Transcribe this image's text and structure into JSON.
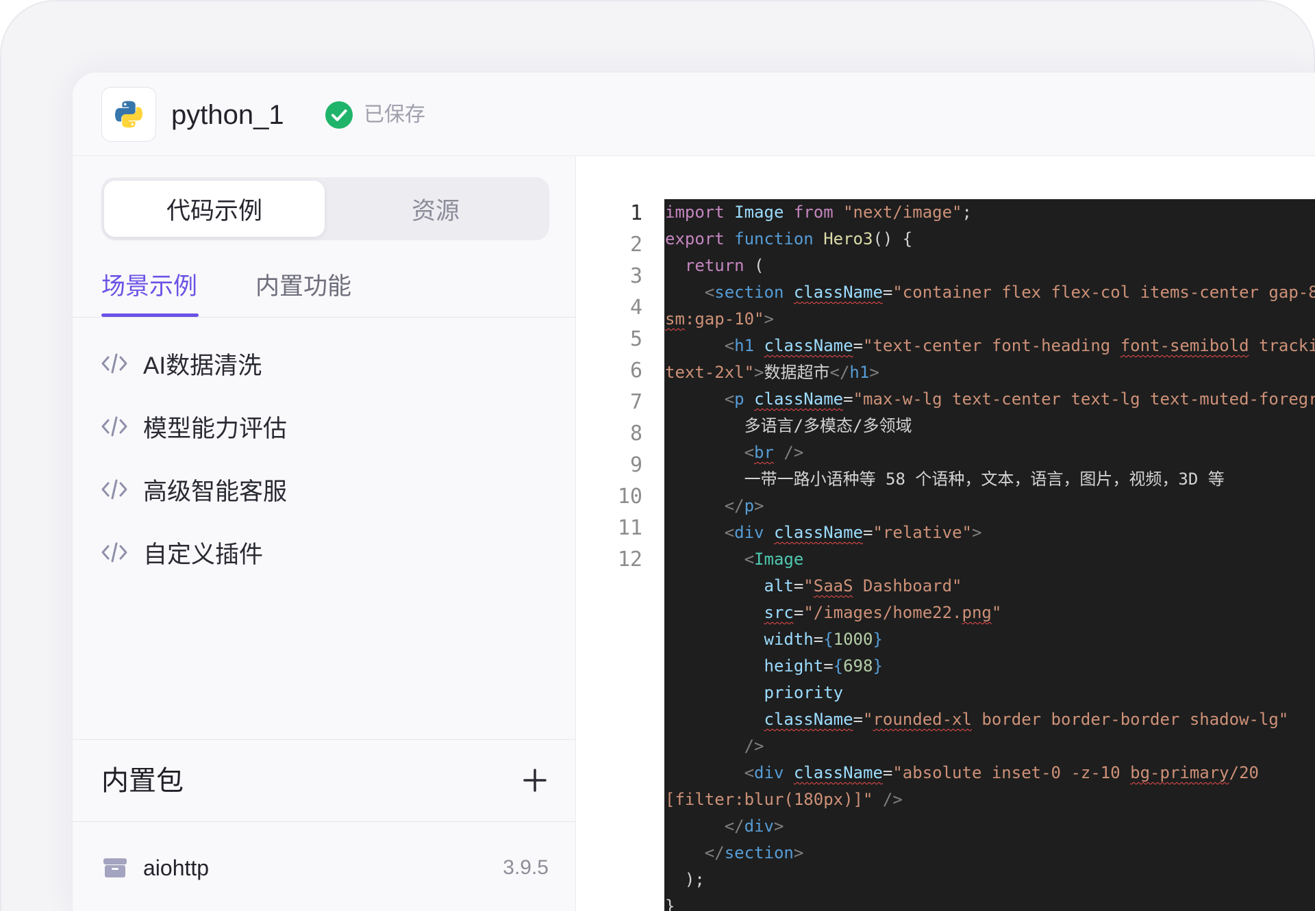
{
  "header": {
    "logo_icon": "python-logo-icon",
    "project_name": "python_1",
    "save_status_icon": "check-circle-icon",
    "save_status": "已保存"
  },
  "sidebar": {
    "segments": [
      {
        "label": "代码示例",
        "active": true
      },
      {
        "label": "资源",
        "active": false
      }
    ],
    "tabs": [
      {
        "label": "场景示例",
        "active": true
      },
      {
        "label": "内置功能",
        "active": false
      }
    ],
    "examples": [
      {
        "label": "AI数据清洗",
        "icon": "code-icon"
      },
      {
        "label": "模型能力评估",
        "icon": "code-icon"
      },
      {
        "label": "高级智能客服",
        "icon": "code-icon"
      },
      {
        "label": "自定义插件",
        "icon": "code-icon"
      }
    ],
    "packages_section": {
      "title": "内置包",
      "add_icon": "plus-icon"
    },
    "packages": [
      {
        "name": "aiohttp",
        "version": "3.9.5",
        "icon": "package-icon"
      }
    ]
  },
  "editor": {
    "line_numbers": [
      "1",
      "2",
      "3",
      "4",
      "5",
      "6",
      "7",
      "8",
      "9",
      "10",
      "11",
      "12"
    ],
    "active_line": 1,
    "code_lines": [
      [
        [
          "import",
          "#c586c0"
        ],
        [
          " Image",
          "#9cdcfe"
        ],
        [
          " from",
          "#c586c0"
        ],
        [
          " \"next/image\"",
          "#ce9178"
        ],
        [
          ";",
          "#d4d4d4"
        ]
      ],
      [
        [
          "export",
          "#c586c0"
        ],
        [
          " function",
          "#569cd6"
        ],
        [
          " Hero3",
          "#dcdcaa"
        ],
        [
          "() {",
          "#d4d4d4"
        ]
      ],
      [
        [
          "  return",
          "#c586c0"
        ],
        [
          " (",
          "#d4d4d4"
        ]
      ],
      [
        [
          "    <",
          "#808080"
        ],
        [
          "section",
          "#569cd6"
        ],
        [
          " ",
          "#d4d4d4"
        ],
        [
          "className",
          "#9cdcfe",
          true
        ],
        [
          "=",
          "#d4d4d4"
        ],
        [
          "\"container flex flex-col items-center gap-8",
          "#ce9178"
        ]
      ],
      [
        [
          "sm",
          "#ce9178",
          true
        ],
        [
          ":gap-10\"",
          "#ce9178"
        ],
        [
          ">",
          "#808080"
        ]
      ],
      [
        [
          "      <",
          "#808080"
        ],
        [
          "h1",
          "#569cd6"
        ],
        [
          " ",
          "#d4d4d4"
        ],
        [
          "className",
          "#9cdcfe",
          true
        ],
        [
          "=",
          "#d4d4d4"
        ],
        [
          "\"text-center font-heading ",
          "#ce9178"
        ],
        [
          "font-semibold",
          "#ce9178",
          true
        ],
        [
          " tracking",
          "#ce9178"
        ]
      ],
      [
        [
          "text-2xl\"",
          "#ce9178"
        ],
        [
          ">",
          "#808080"
        ],
        [
          "数据超市",
          "#d4d4d4"
        ],
        [
          "</",
          "#808080"
        ],
        [
          "h1",
          "#569cd6"
        ],
        [
          ">",
          "#808080"
        ]
      ],
      [
        [
          "      <",
          "#808080"
        ],
        [
          "p",
          "#569cd6"
        ],
        [
          " ",
          "#d4d4d4"
        ],
        [
          "className",
          "#9cdcfe",
          true
        ],
        [
          "=",
          "#d4d4d4"
        ],
        [
          "\"max-w-lg text-center text-lg text-muted-foregr",
          "#ce9178"
        ]
      ],
      [
        [
          "        多语言/多模态/多领域",
          "#d4d4d4"
        ]
      ],
      [
        [
          "        <",
          "#808080"
        ],
        [
          "br",
          "#569cd6",
          true
        ],
        [
          " />",
          "#808080"
        ]
      ],
      [
        [
          "        一带一路小语种等 58 个语种，文本，语言，图片，视频，3D 等",
          "#d4d4d4"
        ]
      ],
      [
        [
          "      </",
          "#808080"
        ],
        [
          "p",
          "#569cd6"
        ],
        [
          ">",
          "#808080"
        ]
      ],
      [
        [
          "      <",
          "#808080"
        ],
        [
          "div",
          "#569cd6"
        ],
        [
          " ",
          "#d4d4d4"
        ],
        [
          "className",
          "#9cdcfe",
          true
        ],
        [
          "=",
          "#d4d4d4"
        ],
        [
          "\"relative\"",
          "#ce9178"
        ],
        [
          ">",
          "#808080"
        ]
      ],
      [
        [
          "        <",
          "#808080"
        ],
        [
          "Image",
          "#4ec9b0"
        ]
      ],
      [
        [
          "          alt",
          "#9cdcfe"
        ],
        [
          "=",
          "#d4d4d4"
        ],
        [
          "\"",
          "#ce9178"
        ],
        [
          "SaaS",
          "#ce9178",
          true
        ],
        [
          " Dashboard\"",
          "#ce9178"
        ]
      ],
      [
        [
          "          ",
          "#d4d4d4"
        ],
        [
          "src",
          "#9cdcfe",
          true
        ],
        [
          "=",
          "#d4d4d4"
        ],
        [
          "\"/images/home22.",
          "#ce9178"
        ],
        [
          "png",
          "#ce9178",
          true
        ],
        [
          "\"",
          "#ce9178"
        ]
      ],
      [
        [
          "          width",
          "#9cdcfe"
        ],
        [
          "=",
          "#d4d4d4"
        ],
        [
          "{",
          "#569cd6"
        ],
        [
          "1000",
          "#b5cea8"
        ],
        [
          "}",
          "#569cd6"
        ]
      ],
      [
        [
          "          height",
          "#9cdcfe"
        ],
        [
          "=",
          "#d4d4d4"
        ],
        [
          "{",
          "#569cd6"
        ],
        [
          "698",
          "#b5cea8"
        ],
        [
          "}",
          "#569cd6"
        ]
      ],
      [
        [
          "          priority",
          "#9cdcfe"
        ]
      ],
      [
        [
          "          ",
          "#d4d4d4"
        ],
        [
          "className",
          "#9cdcfe",
          true
        ],
        [
          "=",
          "#d4d4d4"
        ],
        [
          "\"",
          "#ce9178"
        ],
        [
          "rounded-xl",
          "#ce9178",
          true
        ],
        [
          " border border-border shadow-lg\"",
          "#ce9178"
        ]
      ],
      [
        [
          "        />",
          "#808080"
        ]
      ],
      [
        [
          "        <",
          "#808080"
        ],
        [
          "div",
          "#569cd6"
        ],
        [
          " ",
          "#d4d4d4"
        ],
        [
          "className",
          "#9cdcfe",
          true
        ],
        [
          "=",
          "#d4d4d4"
        ],
        [
          "\"absolute inset-0 -z-10 ",
          "#ce9178"
        ],
        [
          "bg-primary",
          "#ce9178",
          true
        ],
        [
          "/20",
          "#ce9178"
        ]
      ],
      [
        [
          "[filter:blur(180px)]\"",
          "#ce9178"
        ],
        [
          " />",
          "#808080"
        ]
      ],
      [
        [
          "      </",
          "#808080"
        ],
        [
          "div",
          "#569cd6"
        ],
        [
          ">",
          "#808080"
        ]
      ],
      [
        [
          "    </",
          "#808080"
        ],
        [
          "section",
          "#569cd6"
        ],
        [
          ">",
          "#808080"
        ]
      ],
      [
        [
          "  );",
          "#d4d4d4"
        ]
      ],
      [
        [
          "}",
          "#d4d4d4"
        ]
      ]
    ]
  },
  "colors": {
    "accent": "#6c52e6",
    "saved_green": "#1fb46a",
    "code_background": "#1e1e1e",
    "python_blue": "#3776ab",
    "python_yellow": "#ffd43b"
  }
}
